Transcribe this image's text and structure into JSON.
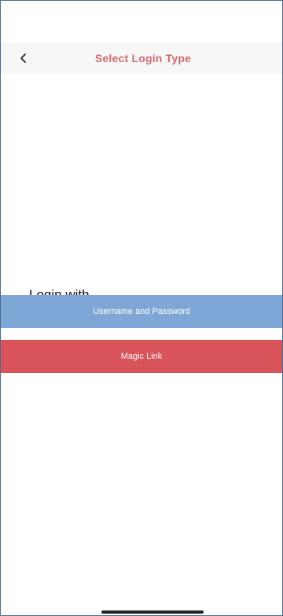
{
  "header": {
    "title": "Select Login Type",
    "back_icon": "chevron-left-icon"
  },
  "main": {
    "prompt": "Login with...",
    "options": [
      {
        "label": "Username and Password",
        "color": "#7ea6d6"
      },
      {
        "label": "Magic Link",
        "color": "#d9535a"
      }
    ]
  },
  "colors": {
    "accent": "#d26a72",
    "header_bg": "#f7f7f7",
    "frame_border": "#4a6a94"
  }
}
